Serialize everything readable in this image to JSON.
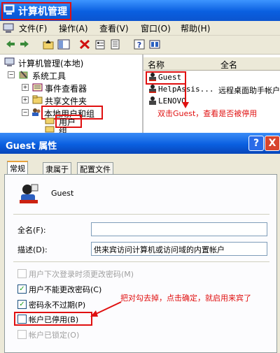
{
  "window": {
    "title": "计算机管理"
  },
  "menubar": {
    "items": [
      "文件(F)",
      "操作(A)",
      "查看(V)",
      "窗口(O)",
      "帮助(H)"
    ]
  },
  "toolbar": {
    "icons": [
      "back-icon",
      "forward-icon",
      "up-icon",
      "show-hide-tree-icon",
      "delete-icon",
      "properties-icon",
      "export-icon",
      "help-icon",
      "view-icon"
    ]
  },
  "tree": {
    "root": "计算机管理(本地)",
    "system_tools": "系统工具",
    "event_viewer": "事件查看器",
    "shared_folders": "共享文件夹",
    "local_users_groups": "本地用户和组",
    "users": "用户",
    "groups": "组"
  },
  "list": {
    "col_name": "名称",
    "col_fullname": "全名",
    "rows": [
      {
        "name": "Guest",
        "fullname": ""
      },
      {
        "name": "HelpAssis...",
        "fullname": "远程桌面助手帐户"
      },
      {
        "name": "LENOVO",
        "fullname": ""
      }
    ],
    "annotation": "双击Guest，查看是否被停用"
  },
  "dialog": {
    "title": "Guest 属性",
    "help_btn": "?",
    "close_btn": "X",
    "tabs": [
      "常规",
      "隶属于",
      "配置文件"
    ],
    "username": "Guest",
    "fullname_label": "全名(F):",
    "fullname_value": "",
    "desc_label": "描述(D):",
    "desc_value": "供来宾访问计算机或访问域的内置帐户",
    "checkboxes": [
      {
        "label": "用户下次登录时须更改密码(M)",
        "checked": false,
        "disabled": true
      },
      {
        "label": "用户不能更改密码(C)",
        "checked": true,
        "disabled": false
      },
      {
        "label": "密码永不过期(P)",
        "checked": true,
        "disabled": false
      },
      {
        "label": "帐户已停用(B)",
        "checked": false,
        "disabled": false
      },
      {
        "label": "帐户已锁定(O)",
        "checked": false,
        "disabled": true
      }
    ],
    "annotation": "把对勾去掉，点击确定，就启用来宾了"
  },
  "colors": {
    "accent_red": "#e01010",
    "xp_blue": "#0a5fe0"
  }
}
